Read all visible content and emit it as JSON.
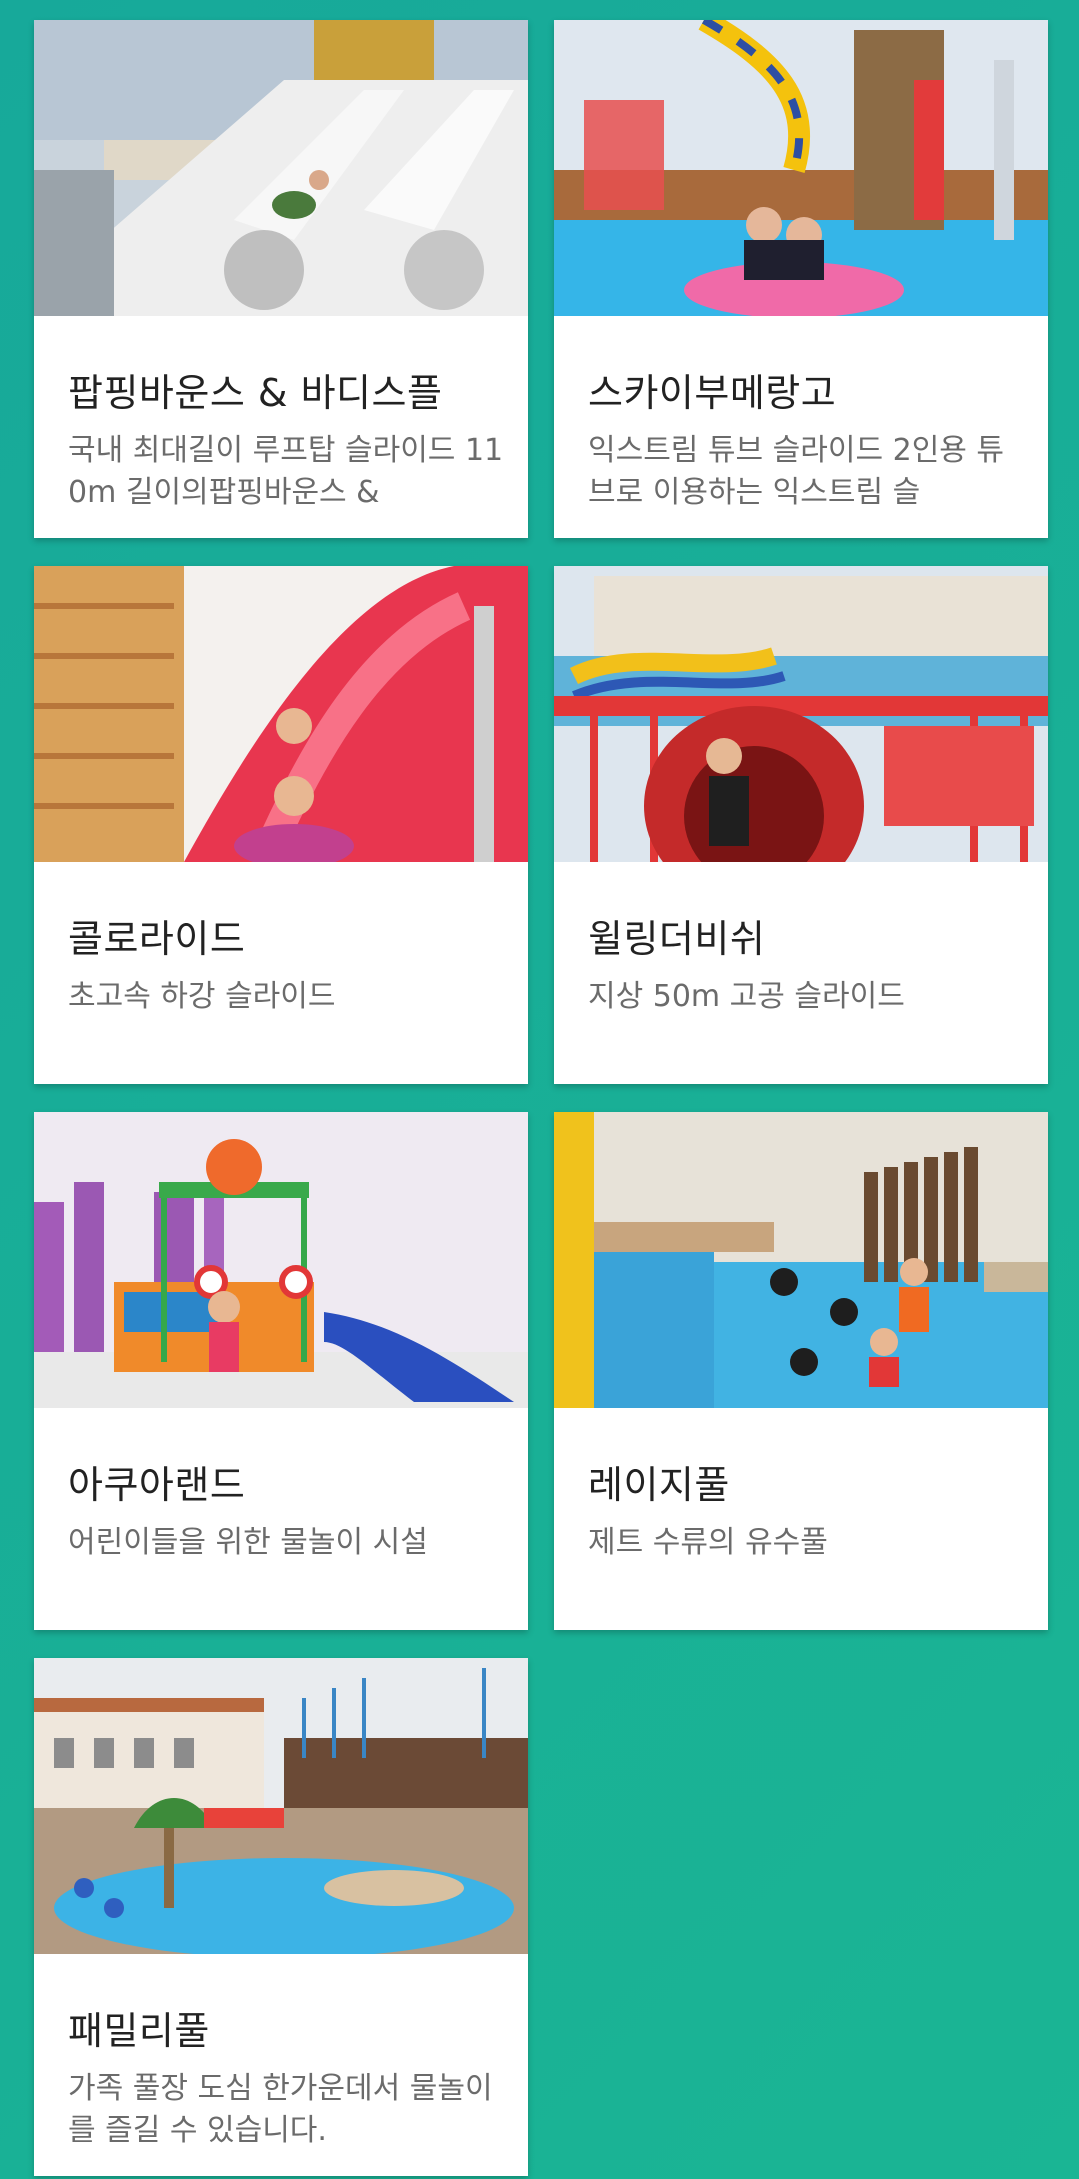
{
  "attractions": [
    {
      "title": "팝핑바운스 & 바디스플",
      "description": "국내 최대길이 루프탑 슬라이드 110m 길이의팝핑바운스 &",
      "image": "popping-bounce-slide-photo"
    },
    {
      "title": "스카이부메랑고",
      "description": "익스트림 튜브 슬라이드 2인용 튜브로 이용하는 익스트림 슬",
      "image": "sky-boomerango-photo"
    },
    {
      "title": "콜로라이드",
      "description": "초고속 하강 슬라이드",
      "image": "colo-ride-photo"
    },
    {
      "title": "윌링더비쉬",
      "description": "지상 50m 고공 슬라이드",
      "image": "whirling-dervish-photo"
    },
    {
      "title": "아쿠아랜드",
      "description": "어린이들을 위한 물놀이 시설",
      "image": "aqualand-photo"
    },
    {
      "title": "레이지풀",
      "description": "제트 수류의 유수풀",
      "image": "lazy-pool-photo"
    },
    {
      "title": "패밀리풀",
      "description": "가족 풀장 도심 한가운데서 물놀이를 즐길 수 있습니다.",
      "image": "family-pool-photo"
    }
  ]
}
